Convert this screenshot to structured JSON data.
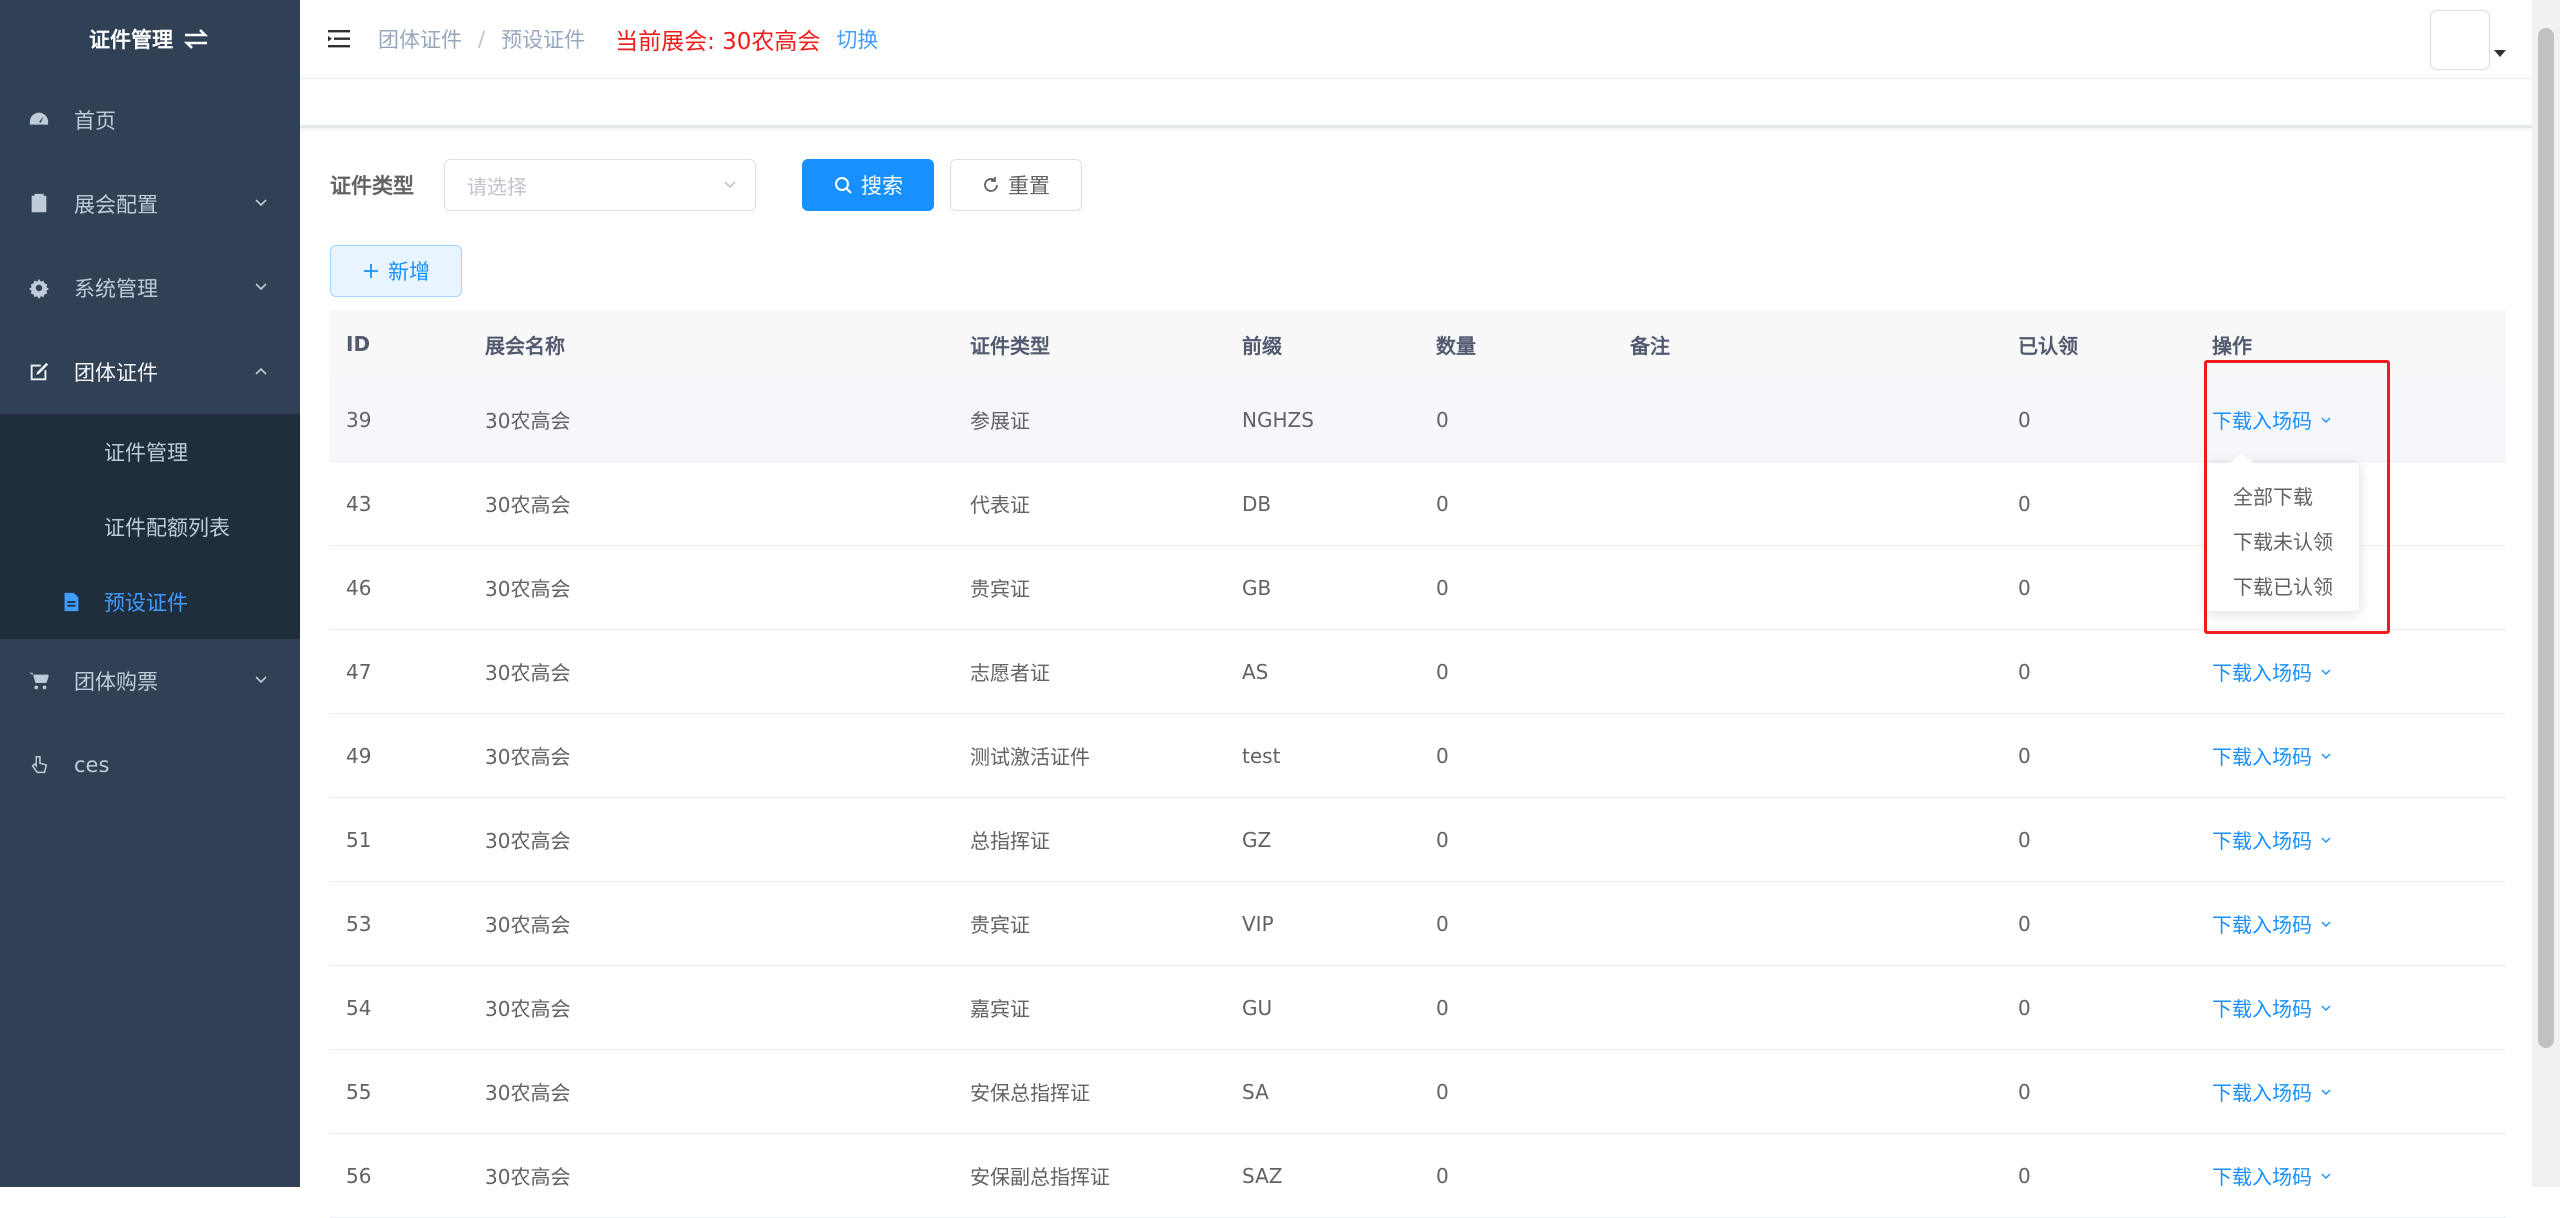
{
  "sidebar": {
    "title": "证件管理",
    "items": [
      {
        "label": "首页",
        "icon": "dashboard-icon"
      },
      {
        "label": "展会配置",
        "icon": "clipboard-icon"
      },
      {
        "label": "系统管理",
        "icon": "gear-icon"
      },
      {
        "label": "团体证件",
        "icon": "edit-icon"
      },
      {
        "label": "团体购票",
        "icon": "cart-icon"
      },
      {
        "label": "ces",
        "icon": "pointer-icon"
      }
    ],
    "subitems": [
      {
        "label": "证件管理"
      },
      {
        "label": "证件配额列表"
      },
      {
        "label": "预设证件",
        "icon": "document-icon"
      }
    ]
  },
  "header": {
    "breadcrumb": [
      "团体证件",
      "预设证件"
    ],
    "current_expo": "当前展会:  30农高会",
    "switch_label": "切换"
  },
  "filter": {
    "label": "证件类型",
    "select_placeholder": "请选择",
    "search_label": "搜索",
    "reset_label": "重置",
    "add_label": "新增"
  },
  "table": {
    "headers": [
      "ID",
      "展会名称",
      "证件类型",
      "前缀",
      "数量",
      "备注",
      "已认领",
      "操作"
    ],
    "rows": [
      {
        "id": "39",
        "name": "30农高会",
        "type": "参展证",
        "prefix": "NGHZS",
        "qty": "0",
        "note": "",
        "claimed": "0",
        "op": "下载入场码"
      },
      {
        "id": "43",
        "name": "30农高会",
        "type": "代表证",
        "prefix": "DB",
        "qty": "0",
        "note": "",
        "claimed": "0",
        "op": ""
      },
      {
        "id": "46",
        "name": "30农高会",
        "type": "贵宾证",
        "prefix": "GB",
        "qty": "0",
        "note": "",
        "claimed": "0",
        "op": ""
      },
      {
        "id": "47",
        "name": "30农高会",
        "type": "志愿者证",
        "prefix": "AS",
        "qty": "0",
        "note": "",
        "claimed": "0",
        "op": "下载入场码"
      },
      {
        "id": "49",
        "name": "30农高会",
        "type": "测试激活证件",
        "prefix": "test",
        "qty": "0",
        "note": "",
        "claimed": "0",
        "op": "下载入场码"
      },
      {
        "id": "51",
        "name": "30农高会",
        "type": "总指挥证",
        "prefix": "GZ",
        "qty": "0",
        "note": "",
        "claimed": "0",
        "op": "下载入场码"
      },
      {
        "id": "53",
        "name": "30农高会",
        "type": "贵宾证",
        "prefix": "VIP",
        "qty": "0",
        "note": "",
        "claimed": "0",
        "op": "下载入场码"
      },
      {
        "id": "54",
        "name": "30农高会",
        "type": "嘉宾证",
        "prefix": "GU",
        "qty": "0",
        "note": "",
        "claimed": "0",
        "op": "下载入场码"
      },
      {
        "id": "55",
        "name": "30农高会",
        "type": "安保总指挥证",
        "prefix": "SA",
        "qty": "0",
        "note": "",
        "claimed": "0",
        "op": "下载入场码"
      },
      {
        "id": "56",
        "name": "30农高会",
        "type": "安保副总指挥证",
        "prefix": "SAZ",
        "qty": "0",
        "note": "",
        "claimed": "0",
        "op": "下载入场码"
      }
    ]
  },
  "dropdown": {
    "items": [
      "全部下载",
      "下载未认领",
      "下载已认领"
    ]
  },
  "colors": {
    "sidebar_bg": "#304156",
    "sidebar_sub_bg": "#1f2d3d",
    "primary": "#1890ff",
    "alert_red": "#f01c1c"
  }
}
